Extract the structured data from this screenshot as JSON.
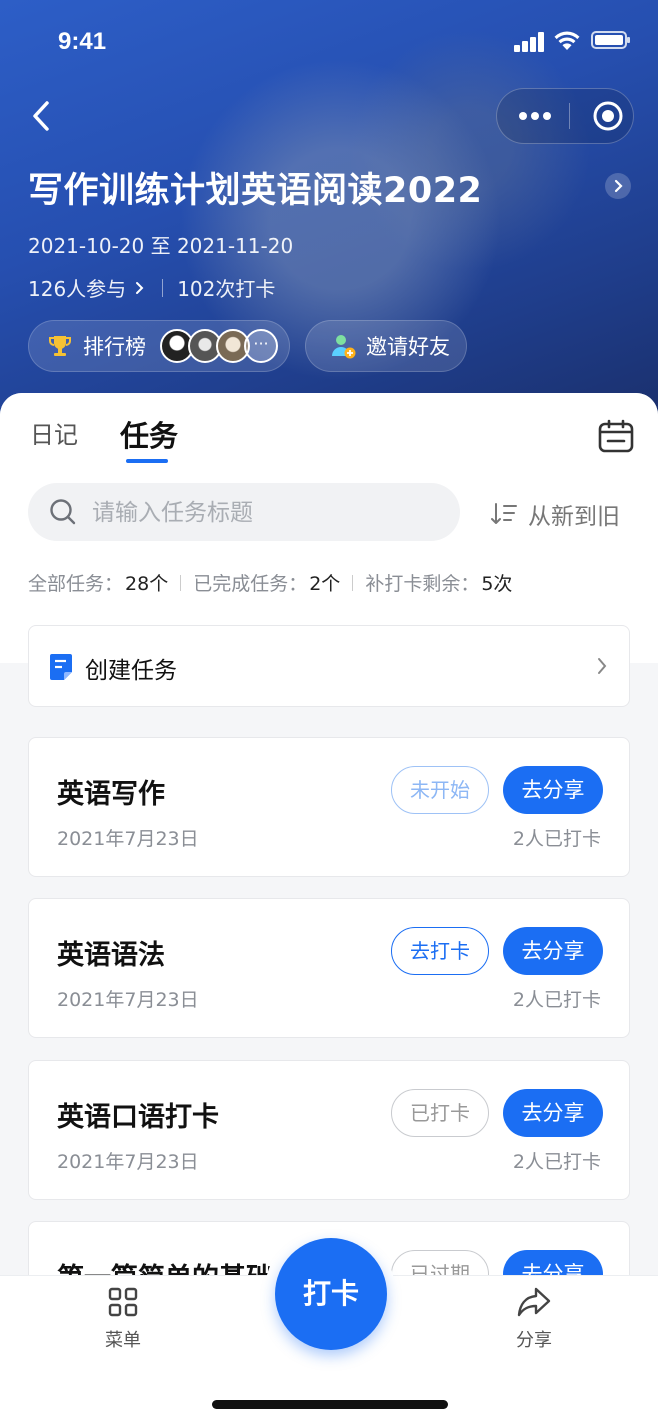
{
  "status_bar": {
    "time": "9:41"
  },
  "header": {
    "title": "写作训练计划英语阅读2022",
    "start_date": "2021-10-20",
    "date_separator": "至",
    "end_date": "2021-11-20",
    "participants": "126人参与",
    "checkins": "102次打卡",
    "ranking_label": "排行榜",
    "invite_label": "邀请好友"
  },
  "tabs": [
    {
      "label": "日记",
      "active": false
    },
    {
      "label": "任务",
      "active": true
    }
  ],
  "search": {
    "placeholder": "请输入任务标题",
    "value": ""
  },
  "sort": {
    "label": "从新到旧"
  },
  "summary": {
    "all_label": "全部任务：",
    "all_value": "28个",
    "done_label": "已完成任务：",
    "done_value": "2个",
    "makeup_label": "补打卡剩余：",
    "makeup_value": "5次"
  },
  "create_task": {
    "label": "创建任务"
  },
  "tasks": [
    {
      "name": "英语写作",
      "date": "2021年7月23日",
      "status": "未开始",
      "share": "去分享",
      "count": "2人已打卡"
    },
    {
      "name": "英语语法",
      "date": "2021年7月23日",
      "status": "去打卡",
      "share": "去分享",
      "count": "2人已打卡"
    },
    {
      "name": "英语口语打卡",
      "date": "2021年7月23日",
      "status": "已打卡",
      "share": "去分享",
      "count": "2人已打卡"
    },
    {
      "name": "第一篇简单的基础",
      "status": "已过期",
      "share": "去分享"
    }
  ],
  "bottom_nav": {
    "menu": "菜单",
    "checkin": "打卡",
    "share": "分享"
  },
  "colors": {
    "primary": "#1b6ef3",
    "header_bg": "#264fb0"
  }
}
